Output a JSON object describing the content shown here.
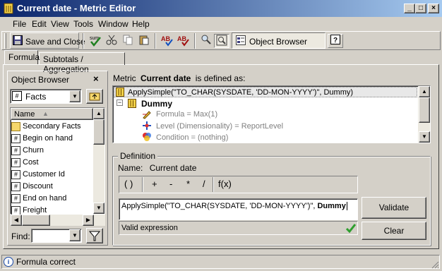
{
  "window": {
    "title": "Current date - Metric Editor",
    "controls": {
      "minimize": "_",
      "maximize": "□",
      "close": "×"
    }
  },
  "menu": [
    "File",
    "Edit",
    "View",
    "Tools",
    "Window",
    "Help"
  ],
  "toolbar": {
    "save_and_close_label": "Save and Close",
    "object_browser_label": "Object Browser"
  },
  "tabs": [
    {
      "label": "Formula",
      "active": true
    },
    {
      "label": "Subtotals / Aggregation",
      "active": false
    }
  ],
  "object_browser": {
    "title": "Object Browser",
    "close": "×",
    "folder_selected": "Facts",
    "column_header": "Name",
    "items": [
      {
        "label": "Secondary Facts",
        "icon": "folder-icon"
      },
      {
        "label": "Begin on hand",
        "icon": "fact-icon"
      },
      {
        "label": "Churn",
        "icon": "fact-icon"
      },
      {
        "label": "Cost",
        "icon": "fact-icon"
      },
      {
        "label": "Customer Id",
        "icon": "fact-icon"
      },
      {
        "label": "Discount",
        "icon": "fact-icon"
      },
      {
        "label": "End on hand",
        "icon": "fact-icon"
      },
      {
        "label": "Freight",
        "icon": "fact-icon"
      }
    ],
    "find_label": "Find:",
    "find_value": ""
  },
  "metric": {
    "caption_prefix": "Metric",
    "name": "Current date",
    "caption_suffix": "is defined as:",
    "tree": {
      "root": "ApplySimple(\"TO_CHAR(SYSDATE, 'DD-MON-YYYY')\", Dummy)",
      "child": "Dummy",
      "expander": "−",
      "properties": [
        {
          "label": "Formula = Max(1)",
          "icon": "formula-icon"
        },
        {
          "label": "Level (Dimensionality) = ReportLevel",
          "icon": "level-icon"
        },
        {
          "label": "Condition = (nothing)",
          "icon": "condition-icon"
        }
      ]
    }
  },
  "definition": {
    "legend": "Definition",
    "name_label": "Name:",
    "name_value": "Current date",
    "operators": [
      "( )",
      "+",
      "-",
      "*",
      "/",
      "f(x)"
    ],
    "formula_prefix": "ApplySimple(\"TO_CHAR(SYSDATE, 'DD-MON-YYYY')\", ",
    "formula_bold": "Dummy",
    "validation_status": "Valid expression",
    "validate_label": "Validate",
    "clear_label": "Clear"
  },
  "statusbar": {
    "text": "Formula correct"
  },
  "colors": {
    "titlebar_start": "#0a246a",
    "titlebar_end": "#a6caf0",
    "face": "#d4d0c8",
    "valid_check": "#2e9e2e"
  }
}
